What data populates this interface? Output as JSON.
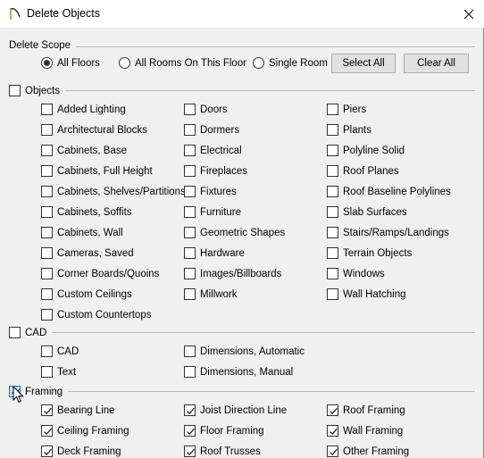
{
  "window": {
    "title": "Delete Objects",
    "icon": "app-arch-icon",
    "close_icon": "close-icon"
  },
  "scope": {
    "label": "Delete Scope",
    "options": [
      {
        "label": "All Floors",
        "selected": true
      },
      {
        "label": "All Rooms On This Floor",
        "selected": false
      },
      {
        "label": "Single Room",
        "selected": false
      }
    ],
    "select_all_label": "Select All",
    "clear_all_label": "Clear All"
  },
  "groups": [
    {
      "label": "Objects",
      "checked": false,
      "columns": [
        [
          {
            "label": "Added Lighting",
            "checked": false
          },
          {
            "label": "Architectural Blocks",
            "checked": false
          },
          {
            "label": "Cabinets, Base",
            "checked": false
          },
          {
            "label": "Cabinets, Full Height",
            "checked": false
          },
          {
            "label": "Cabinets, Shelves/Partitions",
            "checked": false
          },
          {
            "label": "Cabinets, Soffits",
            "checked": false
          },
          {
            "label": "Cabinets, Wall",
            "checked": false
          },
          {
            "label": "Cameras, Saved",
            "checked": false
          },
          {
            "label": "Corner Boards/Quoins",
            "checked": false
          },
          {
            "label": "Custom Ceilings",
            "checked": false
          },
          {
            "label": "Custom Countertops",
            "checked": false
          }
        ],
        [
          {
            "label": "Doors",
            "checked": false
          },
          {
            "label": "Dormers",
            "checked": false
          },
          {
            "label": "Electrical",
            "checked": false
          },
          {
            "label": "Fireplaces",
            "checked": false
          },
          {
            "label": "Fixtures",
            "checked": false
          },
          {
            "label": "Furniture",
            "checked": false
          },
          {
            "label": "Geometric Shapes",
            "checked": false
          },
          {
            "label": "Hardware",
            "checked": false
          },
          {
            "label": "Images/Billboards",
            "checked": false
          },
          {
            "label": "Millwork",
            "checked": false
          }
        ],
        [
          {
            "label": "Piers",
            "checked": false
          },
          {
            "label": "Plants",
            "checked": false
          },
          {
            "label": "Polyline Solid",
            "checked": false
          },
          {
            "label": "Roof Planes",
            "checked": false
          },
          {
            "label": "Roof Baseline Polylines",
            "checked": false
          },
          {
            "label": "Slab Surfaces",
            "checked": false
          },
          {
            "label": "Stairs/Ramps/Landings",
            "checked": false
          },
          {
            "label": "Terrain Objects",
            "checked": false
          },
          {
            "label": "Windows",
            "checked": false
          },
          {
            "label": "Wall Hatching",
            "checked": false
          }
        ]
      ]
    },
    {
      "label": "CAD",
      "checked": false,
      "columns": [
        [
          {
            "label": "CAD",
            "checked": false
          },
          {
            "label": "Text",
            "checked": false
          }
        ],
        [
          {
            "label": "Dimensions, Automatic",
            "checked": false
          },
          {
            "label": "Dimensions, Manual",
            "checked": false
          }
        ],
        []
      ]
    },
    {
      "label": "Framing",
      "checked": true,
      "hovered": true,
      "columns": [
        [
          {
            "label": "Bearing Line",
            "checked": true
          },
          {
            "label": "Ceiling Framing",
            "checked": true
          },
          {
            "label": "Deck Framing",
            "checked": true
          }
        ],
        [
          {
            "label": "Joist Direction Line",
            "checked": true
          },
          {
            "label": "Floor Framing",
            "checked": true
          },
          {
            "label": "Roof Trusses",
            "checked": true
          }
        ],
        [
          {
            "label": "Roof Framing",
            "checked": true
          },
          {
            "label": "Wall Framing",
            "checked": true
          },
          {
            "label": "Other Framing",
            "checked": true
          }
        ]
      ]
    }
  ]
}
